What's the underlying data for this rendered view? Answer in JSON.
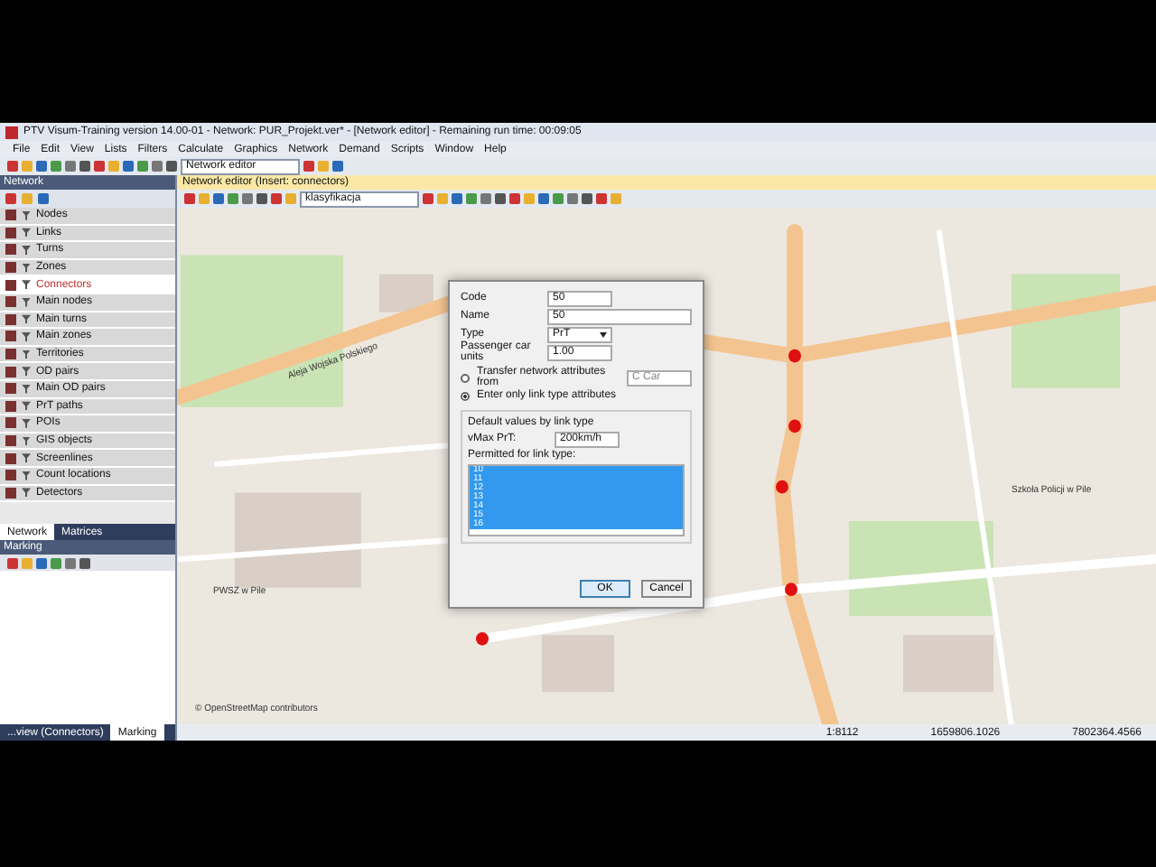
{
  "window": {
    "title": "PTV Visum-Training version 14.00-01 - Network: PUR_Projekt.ver* - [Network editor] - Remaining run time: 00:09:05"
  },
  "menu": [
    "File",
    "Edit",
    "View",
    "Lists",
    "Filters",
    "Calculate",
    "Graphics",
    "Network",
    "Demand",
    "Scripts",
    "Window",
    "Help"
  ],
  "toolbar": {
    "mode": "Network editor"
  },
  "network_panel": {
    "title": "Network",
    "items": [
      {
        "label": "Nodes",
        "selected": false
      },
      {
        "label": "Links",
        "selected": false
      },
      {
        "label": "Turns",
        "selected": false
      },
      {
        "label": "Zones",
        "selected": false
      },
      {
        "label": "Connectors",
        "selected": true
      },
      {
        "label": "Main nodes",
        "selected": false
      },
      {
        "label": "Main turns",
        "selected": false
      },
      {
        "label": "Main zones",
        "selected": false
      },
      {
        "label": "Territories",
        "selected": false
      },
      {
        "label": "OD pairs",
        "selected": false
      },
      {
        "label": "Main OD pairs",
        "selected": false
      },
      {
        "label": "PrT paths",
        "selected": false
      },
      {
        "label": "POIs",
        "selected": false
      },
      {
        "label": "GIS objects",
        "selected": false
      },
      {
        "label": "Screenlines",
        "selected": false
      },
      {
        "label": "Count locations",
        "selected": false
      },
      {
        "label": "Detectors",
        "selected": false
      }
    ],
    "tabs": [
      {
        "label": "Network",
        "selected": true
      },
      {
        "label": "Matrices",
        "selected": false
      }
    ]
  },
  "marking_panel": {
    "title": "Marking"
  },
  "bottom_tabs": [
    {
      "label": "...view (Connectors)",
      "selected": false
    },
    {
      "label": "Marking",
      "selected": true
    }
  ],
  "editor": {
    "title": "Network editor (Insert: connectors)",
    "classification": "klasyfikacja",
    "map_labels": [
      "Aleja Wojska Polskiego",
      "PWSZ w Pile",
      "Szkoła Policji w Pile",
      "© OpenStreetMap contributors"
    ]
  },
  "dialog": {
    "code": "50",
    "name": "50",
    "type": "PrT",
    "pcu": "1.00",
    "transfer": {
      "label": "Transfer network attributes from",
      "selected": false,
      "source": "C Car"
    },
    "enter_only": {
      "label": "Enter only link type attributes",
      "selected": true
    },
    "group_title": "Default values by link type",
    "vmax_label": "vMax PrT:",
    "vmax": "200km/h",
    "permitted_label": "Permitted for link type:",
    "link_types": [
      {
        "label": "10",
        "selected": true
      },
      {
        "label": "11",
        "selected": true
      },
      {
        "label": "12",
        "selected": true
      },
      {
        "label": "13",
        "selected": true
      },
      {
        "label": "14",
        "selected": true
      },
      {
        "label": "15",
        "selected": true
      },
      {
        "label": "16",
        "selected": true
      }
    ],
    "labels": {
      "code": "Code",
      "name": "Name",
      "type": "Type",
      "pcu": "Passenger car units"
    },
    "buttons": [
      "OK",
      "Cancel"
    ]
  },
  "status_bar": [
    "1:8112",
    "1659806.1026",
    "7802364.4566"
  ]
}
